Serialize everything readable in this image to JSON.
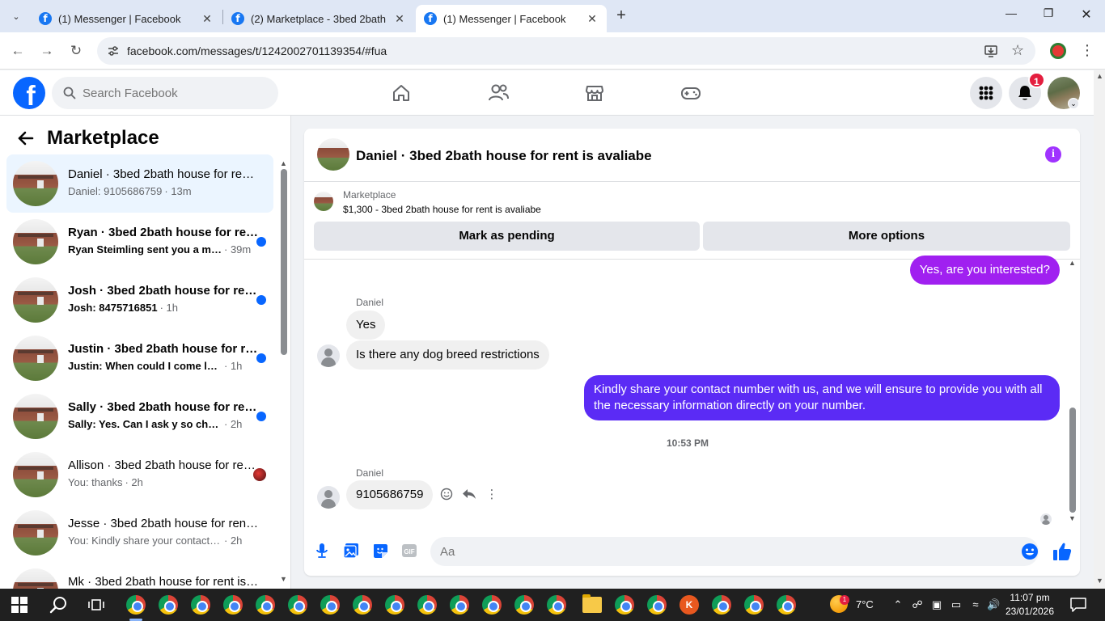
{
  "browser": {
    "tabs": [
      {
        "title": "(1) Messenger | Facebook",
        "active": false
      },
      {
        "title": "(2) Marketplace - 3bed 2bath house for rent",
        "active": false
      },
      {
        "title": "(1) Messenger | Facebook",
        "active": true
      }
    ],
    "url": "facebook.com/messages/t/1242002701139354/#fua"
  },
  "fb_header": {
    "search_placeholder": "Search Facebook",
    "notification_count": "1"
  },
  "sidebar": {
    "title": "Marketplace",
    "conversations": [
      {
        "name": "Daniel · 3bed 2bath house for rent is avaliabe",
        "snippet": "Daniel: 9105686759",
        "time": "· 13m",
        "unread": false,
        "active": true
      },
      {
        "name": "Ryan · 3bed 2bath house for rent is avaliabe",
        "snippet": "Ryan Steimling sent you a message",
        "time": "· 39m",
        "unread": true,
        "active": false
      },
      {
        "name": "Josh · 3bed 2bath house for rent is avaliabe",
        "snippet": "Josh: 8475716851",
        "time": "· 1h",
        "unread": true,
        "active": false
      },
      {
        "name": "Justin · 3bed 2bath house for rent is avaliabe",
        "snippet": "Justin: When could I come look at it",
        "time": "· 1h",
        "unread": true,
        "active": false
      },
      {
        "name": "Sally · 3bed 2bath house for rent is avaliabe",
        "snippet": "Sally: Yes. Can I ask y so cheap",
        "time": "· 2h",
        "unread": true,
        "active": false
      },
      {
        "name": "Allison · 3bed 2bath house for rent is avaliabe",
        "snippet": "You: thanks",
        "time": "· 2h",
        "unread": false,
        "active": false
      },
      {
        "name": "Jesse · 3bed 2bath house for rent is avaliabe",
        "snippet": "You: Kindly share your contact number with us",
        "time": "· 2h",
        "unread": false,
        "active": false
      },
      {
        "name": "Mk · 3bed 2bath house for rent is avaliabe",
        "snippet": "",
        "time": "",
        "unread": false,
        "active": false
      }
    ]
  },
  "chat": {
    "title": "Daniel · 3bed 2bath house for rent is avaliabe",
    "marketplace_label": "Marketplace",
    "listing": "$1,300 - 3bed 2bath house for rent is avaliabe",
    "mark_pending_label": "Mark as pending",
    "more_options_label": "More options",
    "messages": {
      "m1": "Yes, are you interested?",
      "sender1": "Daniel",
      "m2": "Yes",
      "m3": "Is there any dog breed restrictions",
      "m4": "Kindly share your contact number with us, and we will ensure to provide you with all the necessary information directly on your number.",
      "timestamp": "10:53 PM",
      "sender2": "Daniel",
      "m5": "9105686759"
    },
    "composer_placeholder": "Aa"
  },
  "taskbar": {
    "temperature": "7°C",
    "weather_badge": "1",
    "time": "11:07 pm",
    "date": "23/01/2026",
    "k_app_letter": "K"
  }
}
